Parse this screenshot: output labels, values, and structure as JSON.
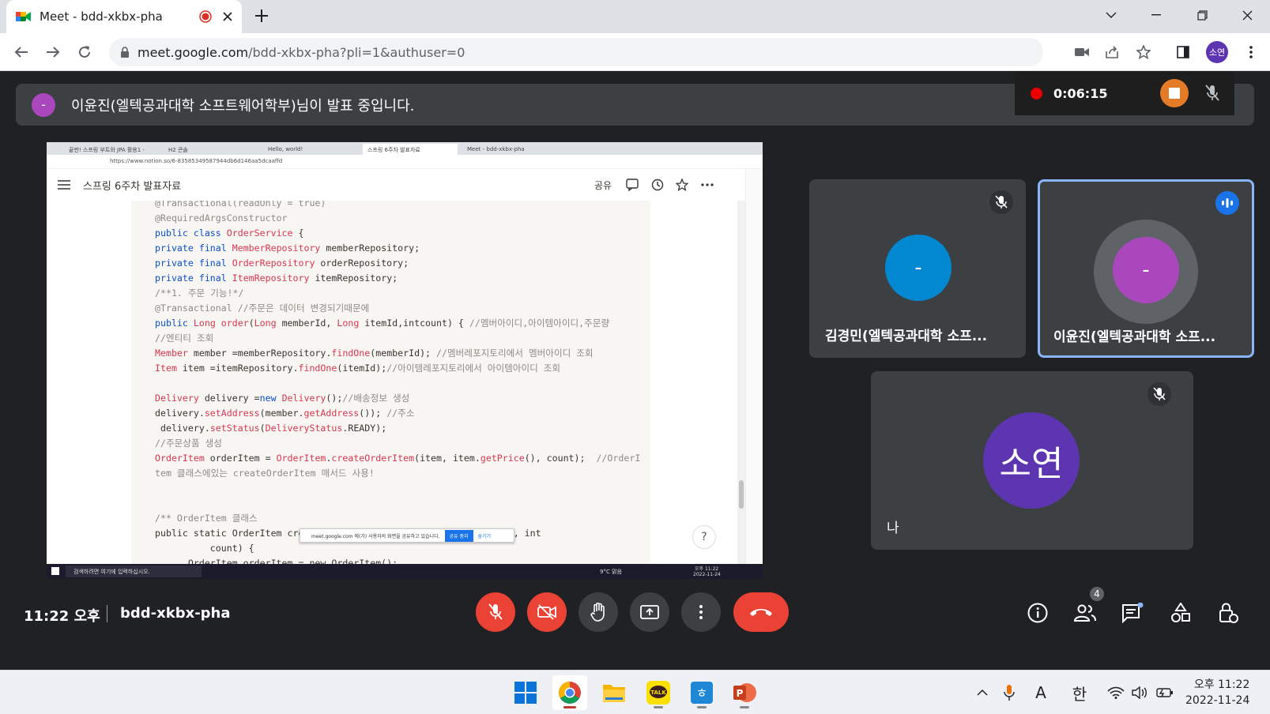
{
  "browser": {
    "tab_title": "Meet - bdd-xkbx-pha",
    "url_host": "meet.google.com",
    "url_path": "/bdd-xkbx-pha?pli=1&authuser=0",
    "profile_initials": "소연"
  },
  "meet": {
    "presenter_banner": "이윤진(엘텍공과대학 소프트웨어학부)님이 발표 중입니다.",
    "presenter_initial": "-",
    "recording_timer": "0:06:15",
    "time": "11:22 오후",
    "meeting_code": "bdd-xkbx-pha",
    "people_count": "4",
    "participants": [
      {
        "name": "김경민(엘텍공과대학 소프...",
        "initial": "-",
        "color": "#0288d1"
      },
      {
        "name": "이윤진(엘텍공과대학 소프...",
        "initial": "-",
        "color": "#ab47bc"
      },
      {
        "name": "나",
        "initial": "소연",
        "color": "#5e35b1"
      }
    ]
  },
  "shared_screen": {
    "tabs": [
      "끝판! 스프링 부트와 JPA 활용1 -",
      "H2 콘솔",
      "Hello, world!",
      "스프링 6주차 발표자료",
      "Meet - bdd-xkbx-pha"
    ],
    "address": "https://www.notion.so/6-83585349587944db6d146aa5dcaaffd",
    "page_title": "스프링 6주차 발표자료",
    "share_label": "공유",
    "help": "?",
    "notice_text": "meet.google.com 에(가) 사용자의 화면을 공유하고 있습니다.",
    "notice_stop": "공유 중지",
    "notice_hide": "숨기기",
    "taskbar_search": "검색하려면 여기에 입력하십시오.",
    "taskbar_weather": "9°C 맑음",
    "taskbar_time": "오후 11:22",
    "taskbar_date": "2022-11-24"
  },
  "taskbar": {
    "time": "오후 11:22",
    "date": "2022-11-24",
    "ime_a": "A",
    "ime_han": "한"
  }
}
